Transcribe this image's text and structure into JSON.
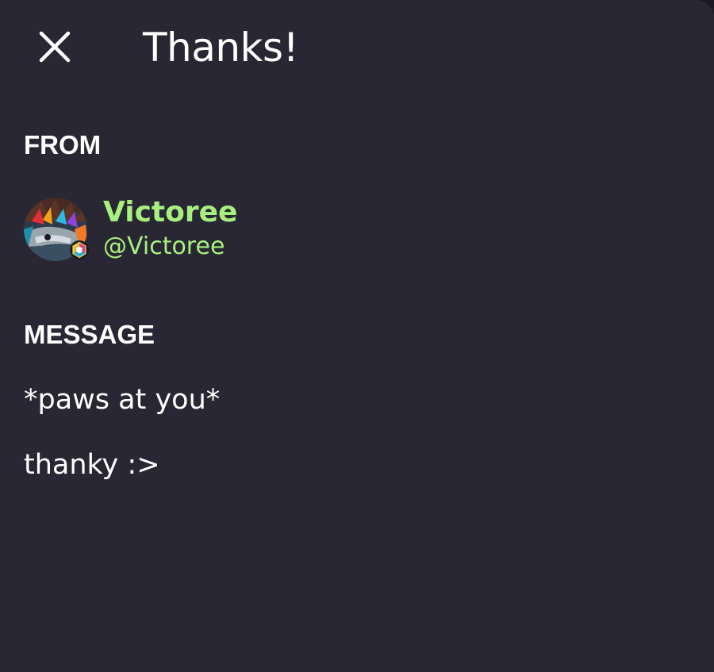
{
  "header": {
    "title": "Thanks!",
    "close_icon": "close-icon"
  },
  "from": {
    "label": "FROM",
    "display_name": "Victoree",
    "handle": "@Victoree",
    "avatar_icon": "avatar",
    "badge_icon": "hexagon-badge-icon"
  },
  "message": {
    "label": "MESSAGE",
    "lines": [
      "*paws at you*",
      "thanky :>"
    ]
  },
  "colors": {
    "background": "#282733",
    "text": "#ffffff",
    "accent_green": "#a8f07e"
  }
}
